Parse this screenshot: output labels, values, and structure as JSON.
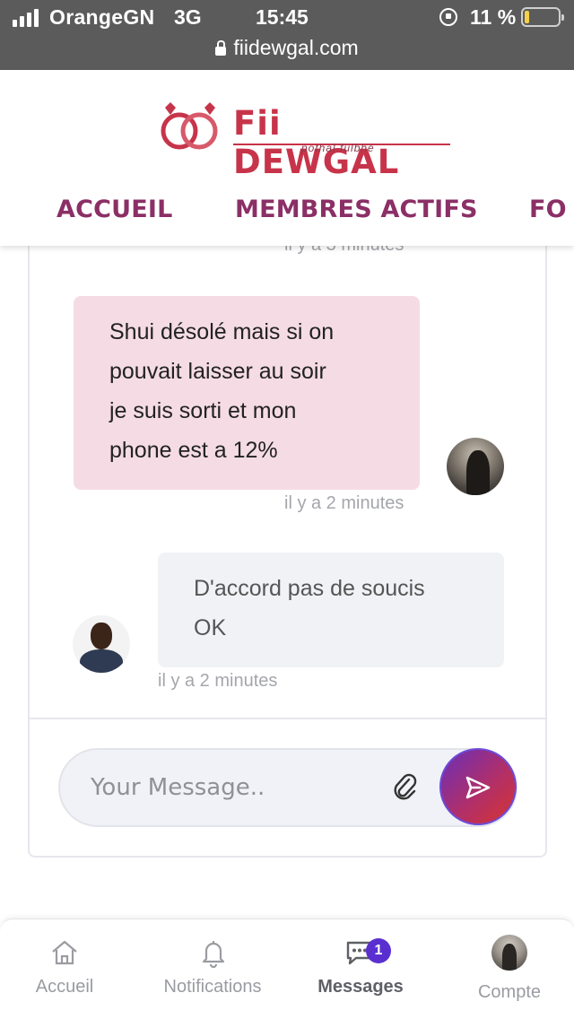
{
  "status_bar": {
    "carrier": "OrangeGN",
    "network": "3G",
    "time": "15:45",
    "battery_pct": "11 %",
    "url": "fiidewgal.com"
  },
  "header": {
    "logo_title": "Fii DEWGAL",
    "logo_subtitle": "pothal fulbhé",
    "nav": [
      "ACCUEIL",
      "MEMBRES ACTIFS",
      "FO"
    ]
  },
  "chat": {
    "top_timestamp": "il y a 3 minutes",
    "messages": [
      {
        "direction": "incoming",
        "lines": [
          "Shui désolé mais si on",
          "pouvait laisser au soir",
          "je suis sorti et mon",
          "phone est a 12%"
        ],
        "time": "il y a 2 minutes"
      },
      {
        "direction": "outgoing",
        "lines": [
          "D'accord pas de soucis",
          "OK"
        ],
        "time": "il y a 2 minutes"
      }
    ],
    "input_placeholder": "Your Message..",
    "input_value": ""
  },
  "bottom_nav": {
    "items": [
      {
        "label": "Accueil",
        "icon": "home-icon"
      },
      {
        "label": "Notifications",
        "icon": "bell-icon"
      },
      {
        "label": "Messages",
        "icon": "chat-icon",
        "badge": "1",
        "active": true
      },
      {
        "label": "Compte",
        "icon": "avatar"
      }
    ]
  },
  "colors": {
    "brand": "#c7344a",
    "nav_text": "#8b2f66",
    "incoming_bubble": "#f5dce4",
    "outgoing_bubble": "#f1f2f6",
    "badge": "#5a2fd0"
  }
}
